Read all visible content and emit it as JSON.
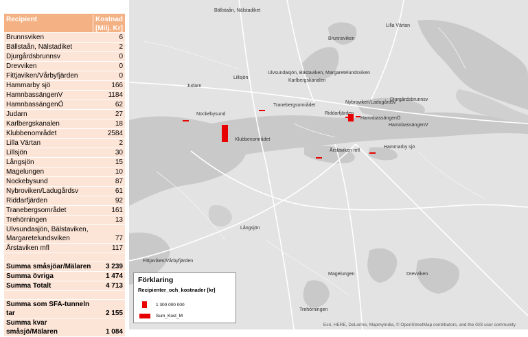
{
  "table": {
    "header": {
      "col1": "Recipient",
      "col2": "Kostnad [Milj. Kr]"
    },
    "rows": [
      {
        "name": "Brunnsviken",
        "value": "6"
      },
      {
        "name": "Bällstaån, Nälstadiket",
        "value": "2"
      },
      {
        "name": "Djurgårdsbrunnsv",
        "value": "0"
      },
      {
        "name": "Drevviken",
        "value": "0"
      },
      {
        "name": "Fittjaviken/Vårbyfjärden",
        "value": "0"
      },
      {
        "name": "Hammarby sjö",
        "value": "166"
      },
      {
        "name": "HamnbassängenV",
        "value": "1184"
      },
      {
        "name": "HamnbassängenÖ",
        "value": "62"
      },
      {
        "name": "Judarn",
        "value": "27"
      },
      {
        "name": "Karlbergskanalen",
        "value": "18"
      },
      {
        "name": "Klubbenområdet",
        "value": "2584"
      },
      {
        "name": "Lilla Värtan",
        "value": "2"
      },
      {
        "name": "Lillsjön",
        "value": "30"
      },
      {
        "name": "Långsjön",
        "value": "15"
      },
      {
        "name": "Magelungen",
        "value": "10"
      },
      {
        "name": "Nockebysund",
        "value": "87"
      },
      {
        "name": "Nybroviken/Ladugårdsv",
        "value": "61"
      },
      {
        "name": "Riddarfjärden",
        "value": "92"
      },
      {
        "name": "Tranebergsområdet",
        "value": "161"
      },
      {
        "name": "Trehörningen",
        "value": "13"
      },
      {
        "name": "Ulvsundasjön, Bälstaviken, Margaretelundsviken",
        "value": "77"
      },
      {
        "name": "Årstaviken mfl",
        "value": "117"
      },
      {
        "name": "",
        "value": ""
      }
    ],
    "summary": [
      {
        "name": "Summa småsjöar/Mälaren",
        "value": "3 239"
      },
      {
        "name": "Summa övriga",
        "value": "1 474"
      },
      {
        "name": "Summa Totalt",
        "value": "4 713"
      },
      {
        "name": "",
        "value": ""
      },
      {
        "name": "Summa som SFA-tunneln tar",
        "value": "2 155"
      },
      {
        "name": "Summa kvar småsjö/Mälaren",
        "value": "1 084"
      }
    ]
  },
  "map": {
    "place_labels": [
      "Bällstaån, Nälstadiket",
      "Lilla Värtan",
      "Brunnsviken",
      "Lillsjön",
      "Ulvsundasjön, Bästaviken, Margaretelundsviken",
      "Karlbergskanalen",
      "Judarn",
      "Nybroviken/Ladugårdsv",
      "Djurgårdsbrunnsv",
      "Tranebergsområdet",
      "Riddarfjärden",
      "Nockebysund",
      "HamnbassängenÖ",
      "HamnbassängenV",
      "Klubbenområdet",
      "Hammarby sjö",
      "Årstaviken mfl",
      "Långsjön",
      "Fittjaviken/Vårbyfjärden",
      "Magelungen",
      "Drevviken",
      "Trehörningen"
    ],
    "attribution": "Esri, HERE, DeLorme, MapmyIndia, © OpenStreetMap contributors, and the GIS user community",
    "bar_color": "#e60000"
  },
  "legend": {
    "title": "Förklaring",
    "subtitle": "Recipienter_och_kostnader [kr]",
    "scale_label": "1 300 000 000",
    "series_label": "Sum_Kost_M"
  }
}
